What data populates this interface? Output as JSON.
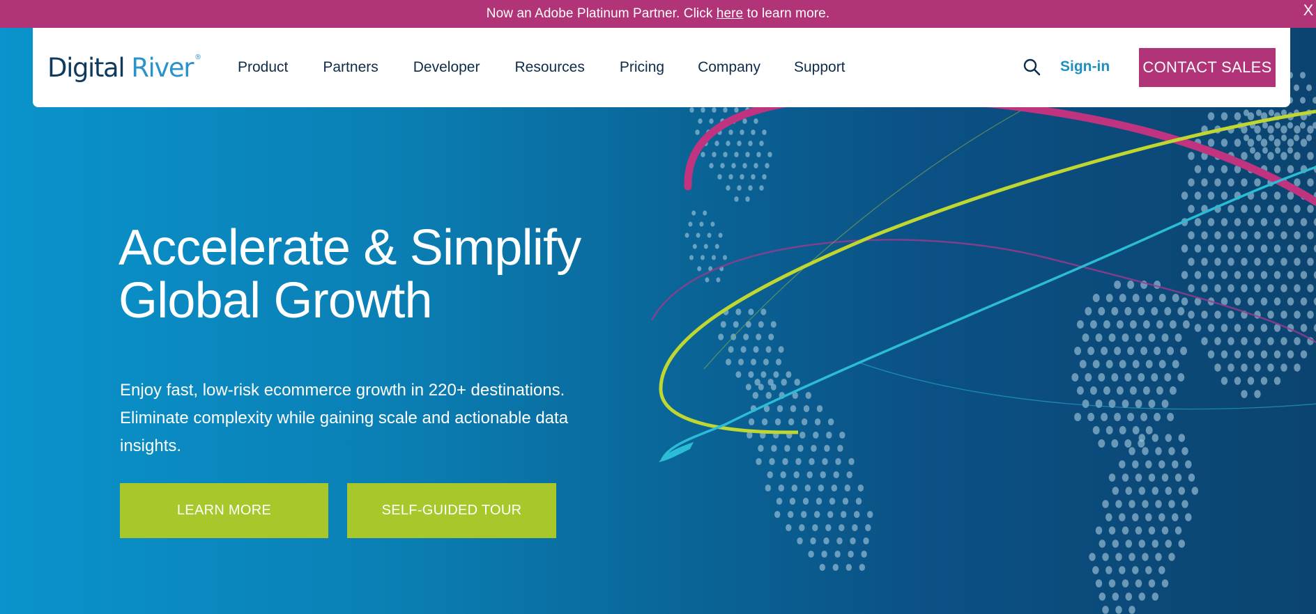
{
  "promo": {
    "text_before": "Now an Adobe Platinum Partner. Click ",
    "link_label": "here",
    "text_after": " to learn more.",
    "close_label": "X",
    "background": "#b23478"
  },
  "nav": {
    "logo": {
      "word1": "Digital",
      "word2": "River",
      "registered": "®"
    },
    "links": [
      {
        "label": "Product"
      },
      {
        "label": "Partners"
      },
      {
        "label": "Developer"
      },
      {
        "label": "Resources"
      },
      {
        "label": "Pricing"
      },
      {
        "label": "Company"
      },
      {
        "label": "Support"
      }
    ],
    "search_icon": "search-icon",
    "signin_label": "Sign-in",
    "contact_label": "CONTACT SALES"
  },
  "hero": {
    "headline_line1": "Accelerate & Simplify",
    "headline_line2": "Global Growth",
    "subtext": "Enjoy fast, low-risk ecommerce growth in 220+ destinations. Eliminate complexity while gaining scale and actionable data insights.",
    "buttons": [
      {
        "label": "LEARN MORE"
      },
      {
        "label": "SELF-GUIDED TOUR"
      }
    ],
    "illustration": "dotted-globe-with-orbits",
    "colors": {
      "accent_magenta": "#b23478",
      "accent_lime": "#a8c72a",
      "accent_cyan": "#2bbcd6",
      "gradient_start": "#0a93cc",
      "gradient_end": "#0b446f"
    }
  }
}
